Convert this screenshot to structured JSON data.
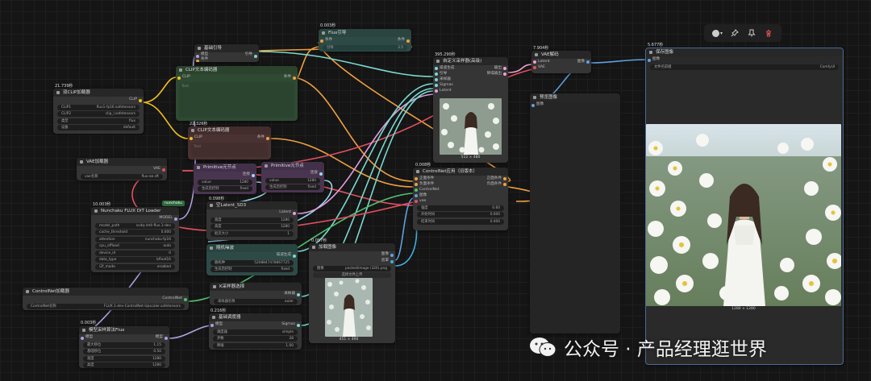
{
  "toolbar": {
    "color_icon": "circle-color-icon",
    "pin_icon": "pin-icon",
    "bookmark_icon": "bookmark-icon",
    "delete_icon": "trash-icon",
    "delete_color": "#e05050"
  },
  "watermark": {
    "text": "公众号 · 产品经理逛世界"
  },
  "nodes": {
    "basic_guider": {
      "title": "基础引导",
      "in1": "模型",
      "in2": "条件",
      "out": "引导"
    },
    "flux_guide": {
      "time": "0.003秒",
      "title": "Flux引导",
      "in": "条件",
      "out": "条件",
      "w_label": "引导",
      "w_value": "3.5"
    },
    "clip_encode_pos": {
      "title": "CLIP文本编码器",
      "in": "CLIP",
      "out": "条件",
      "text": "Text"
    },
    "clip_encode_neg": {
      "time": "22.326秒",
      "title": "CLIP文本编码器",
      "in": "CLIP",
      "out": "条件",
      "text": "Text"
    },
    "dual_clip": {
      "time": "21.739秒",
      "title": "双CLIP加载器",
      "out": "CLIP",
      "widgets": [
        [
          "CLIP1",
          "flux1-fp16.safetensors"
        ],
        [
          "CLIP2",
          "clip_l.safetensors"
        ],
        [
          "类型",
          "flux"
        ],
        [
          "设备",
          "default"
        ]
      ]
    },
    "vae_loader": {
      "title": "VAE加载器",
      "out": "VAE",
      "w_label": "vae名称",
      "w_value": "flux-ae.sft"
    },
    "primitive1": {
      "title": "Primitive元节点",
      "out": "连接",
      "widgets": [
        [
          "value",
          "1280"
        ],
        [
          "生成后控制",
          "fixed"
        ]
      ]
    },
    "primitive2": {
      "title": "Primitive元节点",
      "out": "连接",
      "widgets": [
        [
          "value",
          "1280"
        ],
        [
          "生成后控制",
          "fixed"
        ]
      ]
    },
    "nunchaku": {
      "time": "10.003秒",
      "badge": "nunchaku",
      "title": "Nunchaku FLUX DiT Loader",
      "out": "MODEL",
      "widgets": [
        [
          "model_path",
          "svdq-int4-flux.1-dev"
        ],
        [
          "cache_threshold",
          "0.000"
        ],
        [
          "attention",
          "nunchaku-fp16"
        ],
        [
          "cpu_offload",
          "auto"
        ],
        [
          "device_id",
          "0"
        ],
        [
          "data_type",
          "bfloat16"
        ],
        [
          "i2f_mode",
          "enabled"
        ]
      ]
    },
    "empty_latent": {
      "time": "0.098秒",
      "title": "空Latent_SD3",
      "out": "Latent",
      "widgets": [
        [
          "宽度",
          "1280"
        ],
        [
          "高度",
          "1280"
        ],
        [
          "批次大小",
          "1"
        ]
      ]
    },
    "random_noise": {
      "title": "随机噪波",
      "out": "噪波生成",
      "widgets": [
        [
          "随机种",
          "5208847478867725"
        ],
        [
          "生成后控制",
          "fixed"
        ]
      ]
    },
    "controlnet_loader": {
      "title": "ControlNet加载器",
      "out": "ControlNet",
      "w_label": "ControlNet名称",
      "w_value": "FLUX.1-dev-ControlNet-Upscaler.safetensors"
    },
    "ksampler_select": {
      "title": "K采样器选择",
      "out": "采样器",
      "w_label": "采样器名称",
      "w_value": "euler"
    },
    "basic_scheduler": {
      "time": "0.216秒",
      "title": "基础调度器",
      "in": "模型",
      "out": "Sigmas",
      "widgets": [
        [
          "调度器",
          "simple"
        ],
        [
          "步数",
          "28"
        ],
        [
          "降噪",
          "1.00"
        ]
      ]
    },
    "model_sampling": {
      "time": "0.003秒",
      "title": "模型采样算法Flux",
      "in": "模型",
      "out": "模型",
      "widgets": [
        [
          "最大移位",
          "1.15"
        ],
        [
          "基础移位",
          "0.50"
        ],
        [
          "宽度",
          "1280"
        ],
        [
          "高度",
          "1280"
        ]
      ]
    },
    "load_image": {
      "time": "0.057秒",
      "title": "加载图像",
      "out1": "图像",
      "out2": "遮罩",
      "w_label": "图像",
      "w_value": "pasted/image (326).png",
      "upload": "选择文件上传",
      "caption": "451 × 490"
    },
    "custom_sampler": {
      "time": "395.290秒",
      "title": "自定义采样器(高级)",
      "ins": [
        "噪波生成",
        "引导",
        "采样器",
        "Sigmas",
        "Latent"
      ],
      "outs": [
        "输出",
        "降噪输出"
      ],
      "caption": "512 × 480"
    },
    "controlnet_apply": {
      "time": "0.008秒",
      "title": "ControlNet应用（旧版本）",
      "ins": [
        "正面条件",
        "负面条件",
        "ControlNet",
        "图像",
        "vae"
      ],
      "outs": [
        "正面条件",
        "负面条件"
      ],
      "widgets": [
        [
          "强度",
          "0.60"
        ],
        [
          "开始时间",
          "0.000"
        ],
        [
          "结束时间",
          "0.400"
        ]
      ]
    },
    "vae_decode": {
      "time": "7.904秒",
      "title": "VAE解码",
      "ins": [
        "Latent",
        "VAE"
      ],
      "out": "图像"
    },
    "preview_image": {
      "title": "预览图像",
      "in": "图像"
    },
    "save_image": {
      "time": "5.677秒",
      "title": "保存图像",
      "in": "图像",
      "w_label": "文件名前缀",
      "w_value": "ComfyUI",
      "caption": "1280 × 1280"
    }
  }
}
